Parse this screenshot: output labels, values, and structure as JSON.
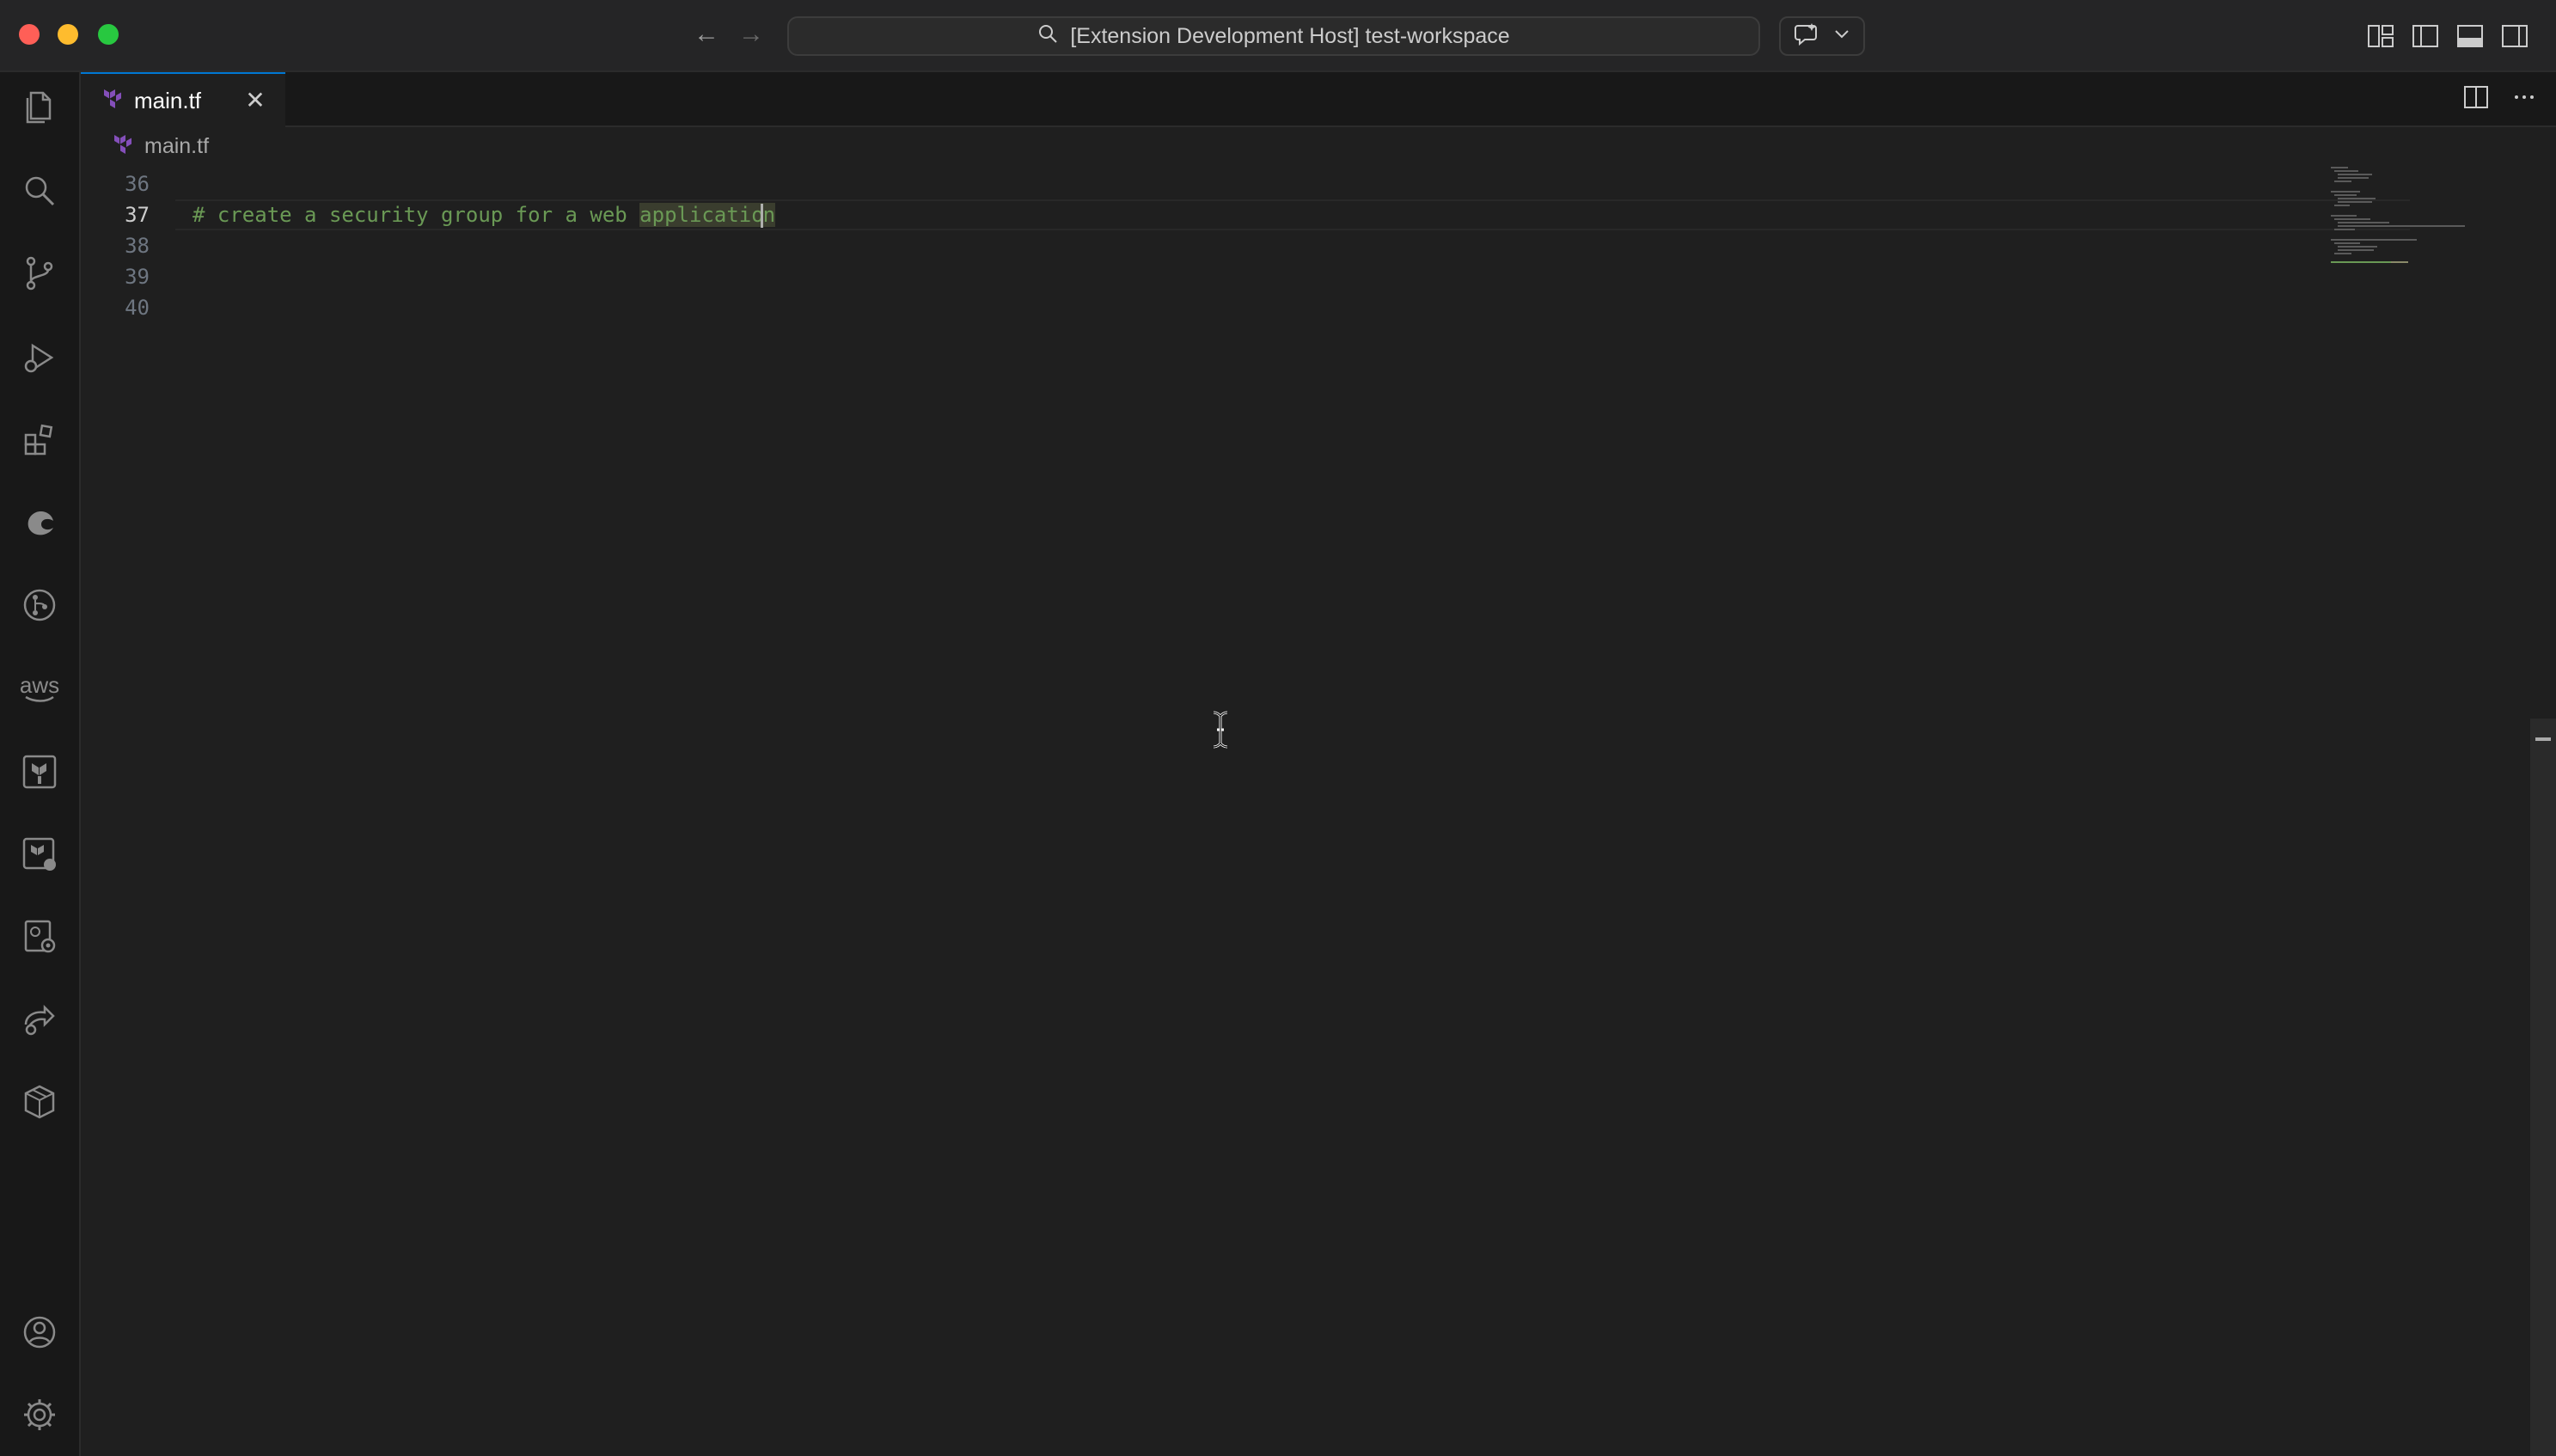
{
  "titlebar": {
    "title": "[Extension Development Host] test-workspace",
    "back_icon": "arrow-left-icon",
    "forward_icon": "arrow-right-icon",
    "search_icon": "search-icon"
  },
  "activity_bar": {
    "items": [
      {
        "name": "explorer",
        "icon": "files-icon"
      },
      {
        "name": "search",
        "icon": "search-icon"
      },
      {
        "name": "source-control",
        "icon": "source-control-icon"
      },
      {
        "name": "run-debug",
        "icon": "run-debug-icon"
      },
      {
        "name": "extensions",
        "icon": "extensions-icon"
      },
      {
        "name": "edge-tools",
        "icon": "edge-icon"
      },
      {
        "name": "gitlens",
        "icon": "git-graph-icon"
      },
      {
        "name": "aws",
        "icon": "aws-icon",
        "label": "aws"
      },
      {
        "name": "terraform",
        "icon": "terraform-icon"
      },
      {
        "name": "terraform-cloud",
        "icon": "terraform-cloud-icon"
      },
      {
        "name": "remote-explorer",
        "icon": "remote-explorer-icon"
      },
      {
        "name": "live-share",
        "icon": "live-share-icon"
      },
      {
        "name": "containers",
        "icon": "box-icon"
      }
    ],
    "accounts_icon": "account-icon",
    "manage_icon": "gear-icon"
  },
  "tabs": [
    {
      "label": "main.tf",
      "icon": "terraform-file-icon",
      "active": true
    }
  ],
  "breadcrumb": {
    "file": "main.tf"
  },
  "editor": {
    "lines": [
      {
        "number": "36",
        "text": ""
      },
      {
        "number": "37",
        "text": "# create a security group for a web ",
        "highlight": "applicatio",
        "after": "n",
        "active": true
      },
      {
        "number": "38",
        "text": ""
      },
      {
        "number": "39",
        "text": ""
      },
      {
        "number": "40",
        "text": ""
      }
    ]
  },
  "colors": {
    "accent": "#0078d4",
    "comment": "#6a9955",
    "terraform": "#844fba"
  }
}
